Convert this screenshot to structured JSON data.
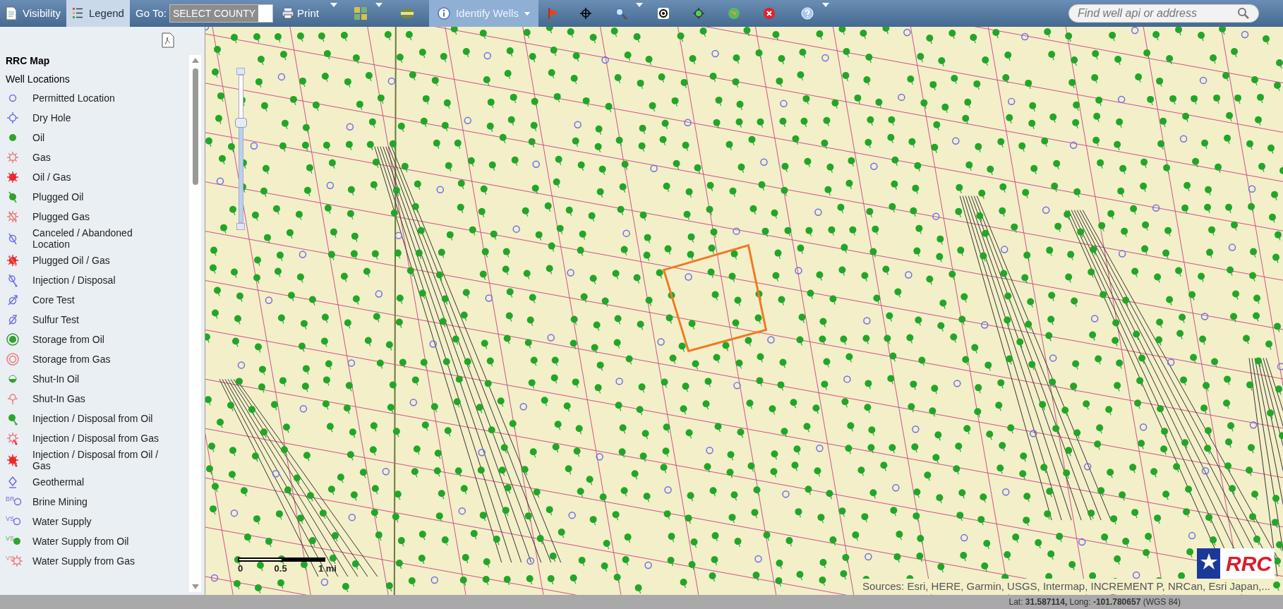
{
  "toolbar": {
    "visibility": {
      "label": "Visibility",
      "selected": false
    },
    "legend": {
      "label": "Legend",
      "selected": true
    },
    "goto_label": "Go To:",
    "county_select": {
      "value": "SELECT COUNTY"
    },
    "print": {
      "label": "Print"
    },
    "identify": {
      "label": "Identify Wells",
      "selected": true
    },
    "search": {
      "placeholder": "Find well api or address"
    }
  },
  "legend": {
    "title": "RRC Map",
    "group": "Well Locations",
    "items": [
      {
        "label": "Permitted Location"
      },
      {
        "label": "Dry Hole"
      },
      {
        "label": "Oil"
      },
      {
        "label": "Gas"
      },
      {
        "label": "Oil / Gas"
      },
      {
        "label": "Plugged Oil"
      },
      {
        "label": "Plugged Gas"
      },
      {
        "label": "Canceled / Abandoned Location"
      },
      {
        "label": "Plugged Oil / Gas"
      },
      {
        "label": "Injection / Disposal"
      },
      {
        "label": "Core Test"
      },
      {
        "label": "Sulfur Test"
      },
      {
        "label": "Storage from Oil"
      },
      {
        "label": "Storage from Gas"
      },
      {
        "label": "Shut-In Oil"
      },
      {
        "label": "Shut-In Gas"
      },
      {
        "label": "Injection / Disposal from Oil"
      },
      {
        "label": "Injection / Disposal from Gas"
      },
      {
        "label": "Injection / Disposal from Oil / Gas"
      },
      {
        "label": "Geothermal"
      },
      {
        "label": "Brine Mining",
        "prefix": "BR"
      },
      {
        "label": "Water Supply",
        "prefix": "VS"
      },
      {
        "label": "Water Supply from Oil",
        "prefix": "VS"
      },
      {
        "label": "Water Supply from Gas",
        "prefix": "VS"
      }
    ]
  },
  "map": {
    "zoom_slider": {
      "level": 0.68
    },
    "scale_labels": [
      "0",
      "0.5",
      "1 mi"
    ],
    "attribution": "Sources: Esri, HERE, Garmin, USGS, Intermap, INCREMENT P, NRCan, Esri Japan,...",
    "logo_text": "RRC"
  },
  "status_bar": {
    "coordinates": "Lat: **31.587114,** Long: **-101.780657** (WGS 84)"
  }
}
